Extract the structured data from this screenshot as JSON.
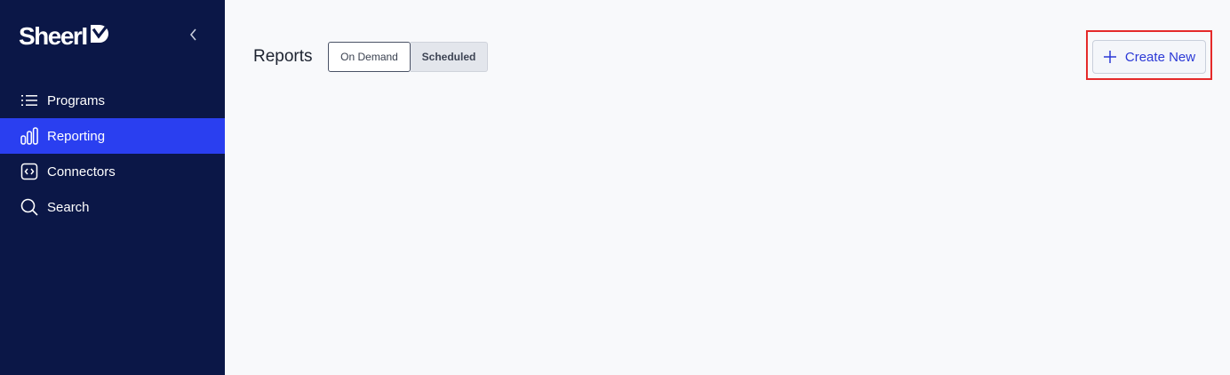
{
  "sidebar": {
    "logo_text": "SheerI",
    "collapse_icon": "chevron-left-icon",
    "items": [
      {
        "label": "Programs",
        "icon": "list-icon",
        "active": false
      },
      {
        "label": "Reporting",
        "icon": "bar-chart-icon",
        "active": true
      },
      {
        "label": "Connectors",
        "icon": "code-brackets-icon",
        "active": false
      },
      {
        "label": "Search",
        "icon": "search-icon",
        "active": false
      }
    ],
    "colors": {
      "background": "#0b1747",
      "active": "#2a3ff0"
    }
  },
  "main": {
    "title": "Reports",
    "tabs": [
      {
        "label": "On Demand",
        "selected": true
      },
      {
        "label": "Scheduled",
        "selected": false
      }
    ],
    "create_button": {
      "label": "Create New",
      "icon": "plus-icon"
    },
    "colors": {
      "accent": "#2b39d6",
      "highlight": "#e52a2a"
    }
  }
}
